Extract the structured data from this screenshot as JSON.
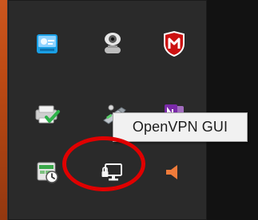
{
  "tooltip": {
    "text": "OpenVPN GUI"
  },
  "tray": {
    "icons": [
      {
        "name": "control-panel-icon"
      },
      {
        "name": "webcam-icon"
      },
      {
        "name": "mcafee-icon"
      },
      {
        "name": "printer-check-icon"
      },
      {
        "name": "usb-drive-icon"
      },
      {
        "name": "onenote-icon"
      },
      {
        "name": "task-scheduler-icon"
      },
      {
        "name": "openvpn-network-icon"
      },
      {
        "name": "speaker-icon"
      }
    ]
  },
  "colors": {
    "highlight": "#e00000",
    "accent": "#c64d14",
    "panel": "#2a2a2a",
    "mcafee": "#c11",
    "tooltip_bg": "#f1f1f1"
  }
}
